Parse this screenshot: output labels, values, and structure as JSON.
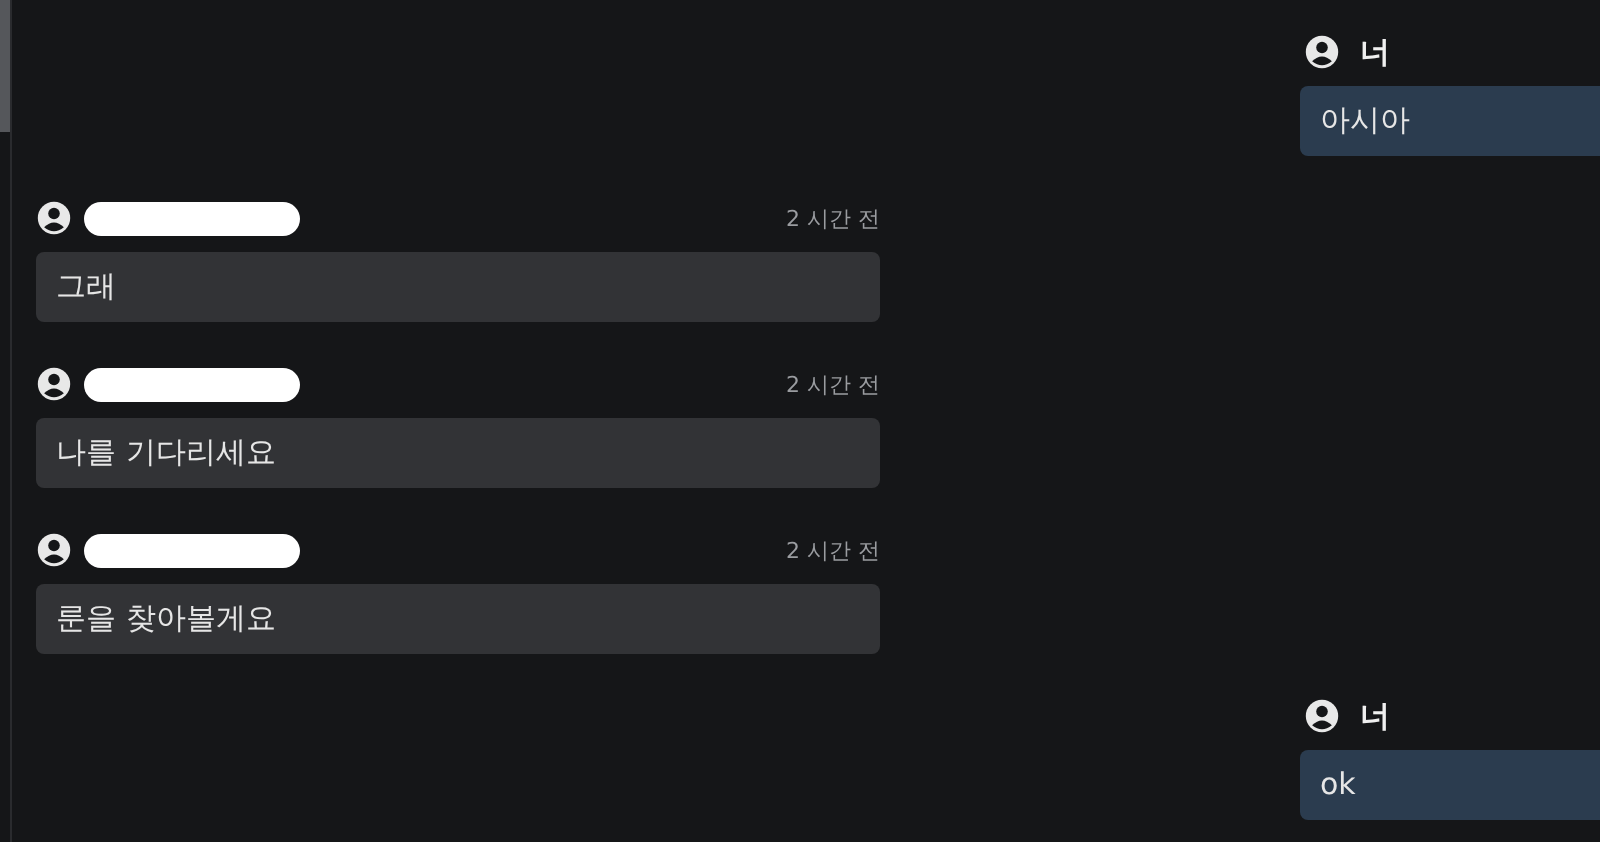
{
  "messages": [
    {
      "kind": "outgoing",
      "author": "너",
      "text": "아시아"
    },
    {
      "kind": "incoming",
      "time": "2 시간 전",
      "text": "그래"
    },
    {
      "kind": "incoming",
      "time": "2 시간 전",
      "text": "나를 기다리세요"
    },
    {
      "kind": "incoming",
      "time": "2 시간 전",
      "text": "룬을 찾아볼게요"
    },
    {
      "kind": "outgoing",
      "author": "너",
      "text": "ok"
    }
  ]
}
